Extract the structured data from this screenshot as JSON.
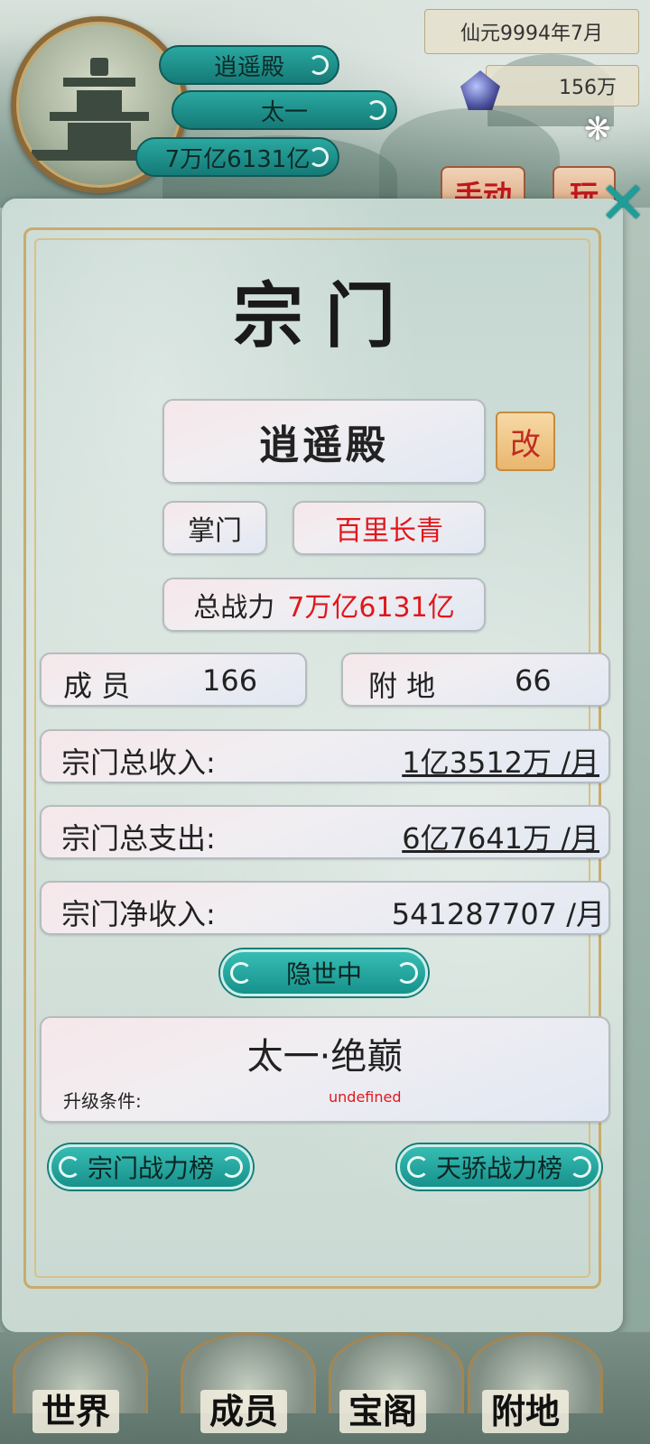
{
  "header": {
    "sect_pill": "逍遥殿",
    "realm_pill": "太一",
    "power_pill": "7万亿6131亿",
    "date": "仙元9994年7月",
    "spirit_stones": "156万",
    "peek_button_1": "手动",
    "peek_button_2": "玩"
  },
  "panel": {
    "title": "宗门",
    "sect_name": "逍遥殿",
    "edit_label": "改",
    "leader_label": "掌门",
    "leader_name": "百里长青",
    "power_label": "总战力",
    "power_value": "7万亿6131亿",
    "members_label": "成 员",
    "members_value": "166",
    "land_label": "附 地",
    "land_value": "66",
    "income_label": "宗门总收入:",
    "income_value": "1亿3512万 /月",
    "expense_label": "宗门总支出:",
    "expense_value": "6亿7641万 /月",
    "net_label": "宗门净收入:",
    "net_value": "541287707 /月",
    "status_button": "隐世中",
    "next_realm": "太一·绝巅",
    "upgrade_label": "升级条件:",
    "upgrade_value": "undefined",
    "sect_rank_button": "宗门战力榜",
    "genius_rank_button": "天骄战力榜"
  },
  "bottom_nav": [
    {
      "label": "世界"
    },
    {
      "label": "成员"
    },
    {
      "label": "宝阁"
    },
    {
      "label": "附地"
    }
  ],
  "icons": {
    "settings": "gear-icon",
    "close": "close-icon",
    "spirit": "spirit-stone-icon"
  }
}
